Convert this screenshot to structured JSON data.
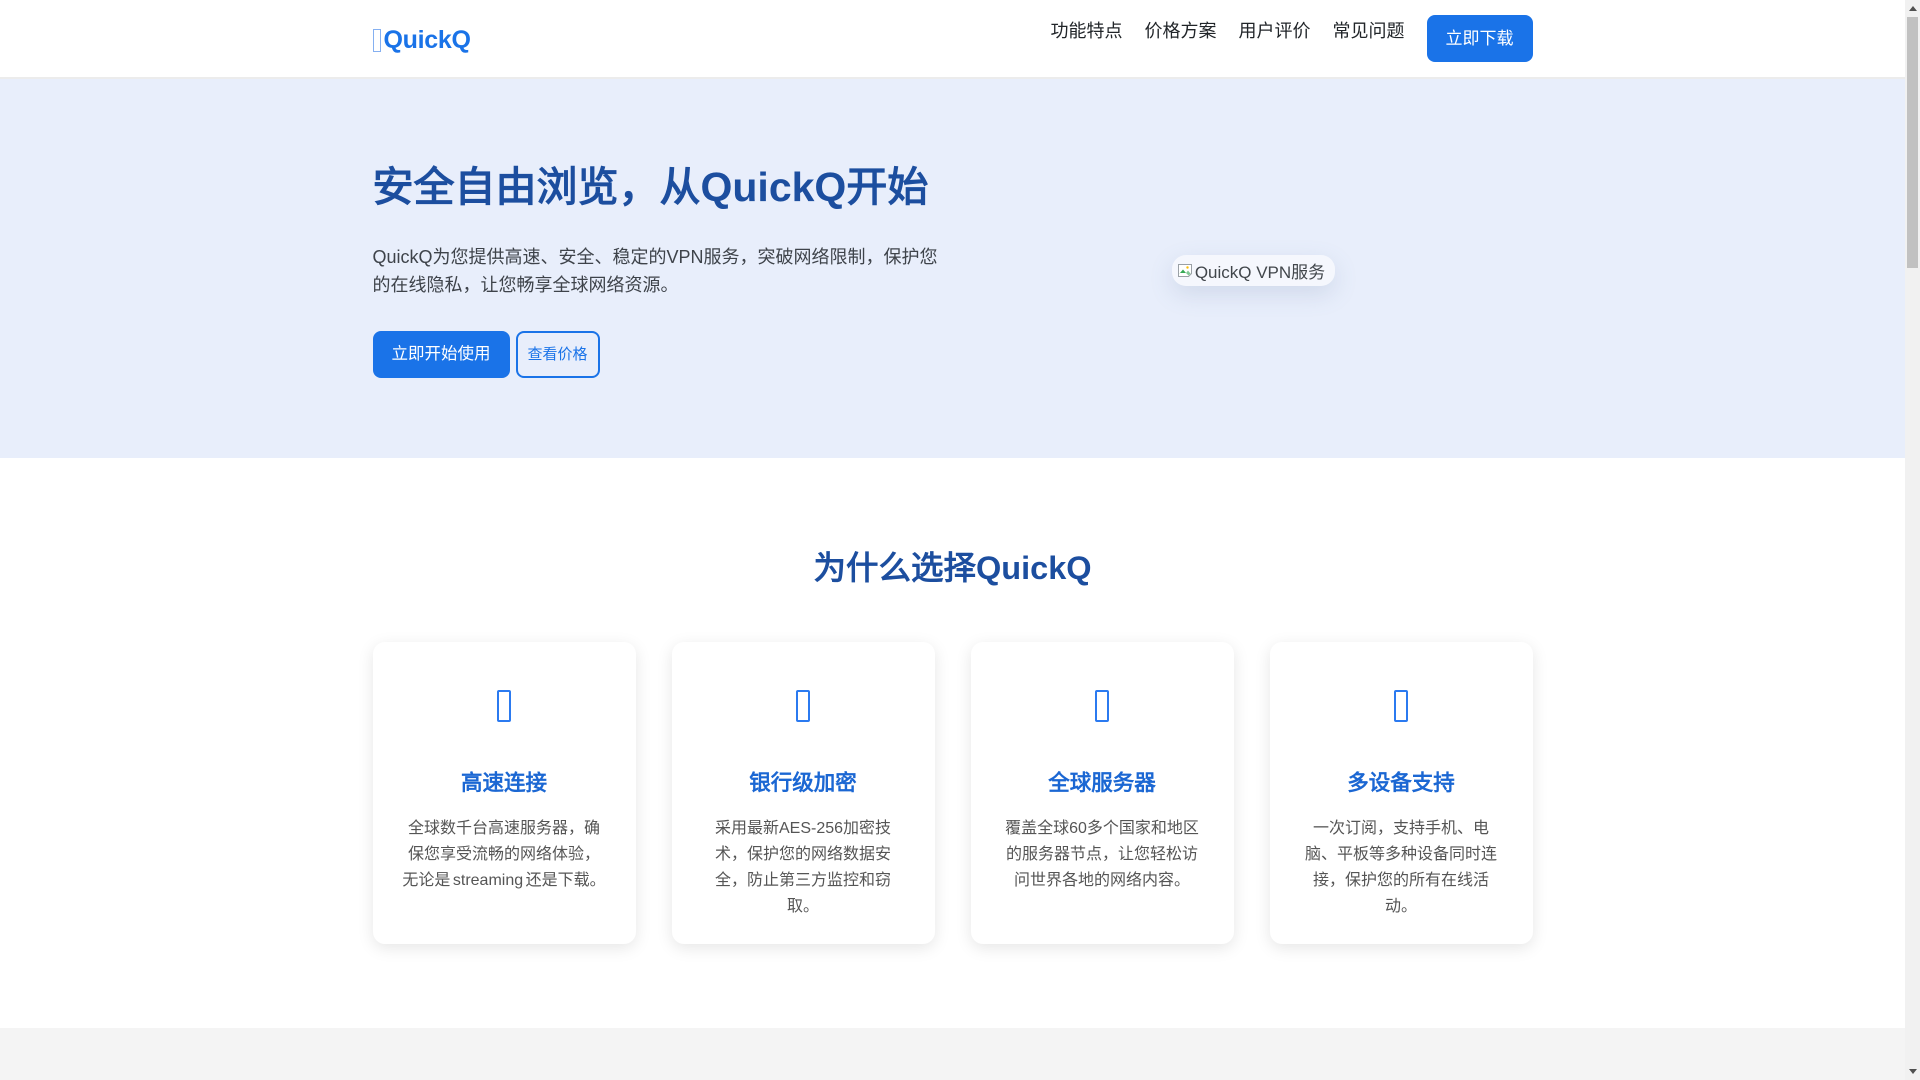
{
  "brand": {
    "name": "QuickQ"
  },
  "nav": {
    "links": [
      "功能特点",
      "价格方案",
      "用户评价",
      "常见问题"
    ],
    "cta_label": "立即下载"
  },
  "hero": {
    "title": "安全自由浏览，从QuickQ开始",
    "description": "QuickQ为您提供高速、安全、稳定的VPN服务，突破网络限制，保护您的在线隐私，让您畅享全球网络资源。",
    "primary_cta": "立即开始使用",
    "secondary_cta": "查看价格",
    "image_alt": "QuickQ VPN服务"
  },
  "features": {
    "title": "为什么选择QuickQ",
    "cards": [
      {
        "title": "高速连接",
        "description": "全球数千台高速服务器，确保您享受流畅的网络体验，无论是 streaming 还是下载。"
      },
      {
        "title": "银行级加密",
        "description": "采用最新AES-256加密技术，保护您的网络数据安全，防止第三方监控和窃取。"
      },
      {
        "title": "全球服务器",
        "description": "覆盖全球60多个国家和地区的服务器节点，让您轻松访问世界各地的网络内容。"
      },
      {
        "title": "多设备支持",
        "description": "一次订阅，支持手机、电脑、平板等多种设备同时连接，保护您的所有在线活动。"
      }
    ]
  },
  "colors": {
    "accent": "#1a73e8",
    "navy": "#1c4e9f",
    "card_title": "#1b67d3",
    "hero_bg": "#e8eefb",
    "section_bg": "#f4f4f4"
  }
}
